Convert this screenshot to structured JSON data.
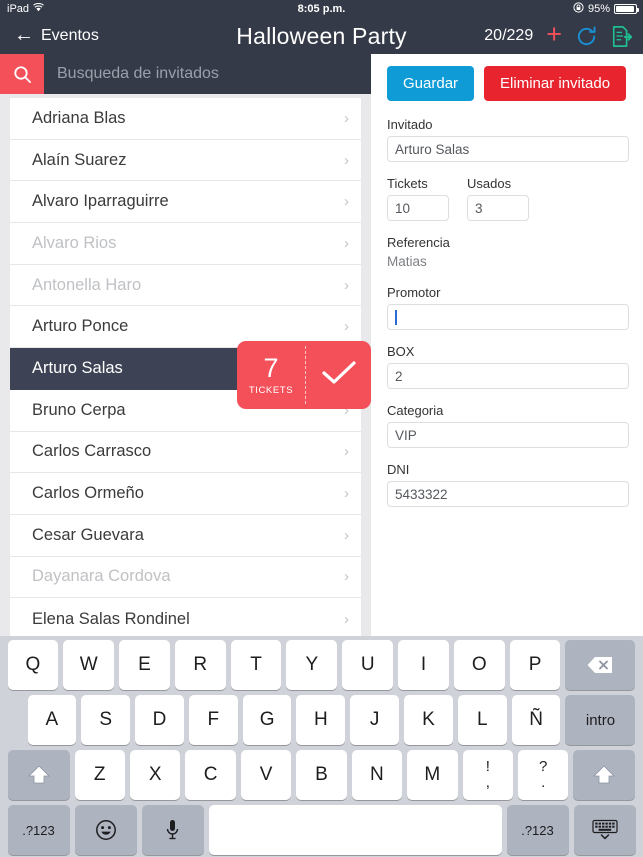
{
  "status_bar": {
    "device": "iPad",
    "wifi_icon": "wifi-icon",
    "time": "8:05 p.m.",
    "rotation_lock_icon": "rotation-lock-icon",
    "battery_percent": "95%"
  },
  "nav_bar": {
    "back_label": "Eventos",
    "back_icon": "back-arrow-icon",
    "title": "Halloween Party",
    "count": "20/229",
    "add_icon": "plus-icon",
    "refresh_icon": "refresh-icon",
    "export_icon": "export-document-icon",
    "accent_add": "#f4505a",
    "accent_refresh": "#1a8fd1",
    "accent_export": "#1fbf92"
  },
  "search": {
    "icon": "search-icon",
    "placeholder": "Busqueda de invitados",
    "value": ""
  },
  "guest_list": [
    {
      "name": "Adriana Blas",
      "dim": false,
      "selected": false
    },
    {
      "name": "Alaín Suarez",
      "dim": false,
      "selected": false
    },
    {
      "name": "Alvaro Iparraguirre",
      "dim": false,
      "selected": false
    },
    {
      "name": "Alvaro Rios",
      "dim": true,
      "selected": false
    },
    {
      "name": "Antonella Haro",
      "dim": true,
      "selected": false
    },
    {
      "name": "Arturo Ponce",
      "dim": false,
      "selected": false
    },
    {
      "name": "Arturo Salas",
      "dim": false,
      "selected": true
    },
    {
      "name": "Bruno Cerpa",
      "dim": false,
      "selected": false
    },
    {
      "name": "Carlos Carrasco",
      "dim": false,
      "selected": false
    },
    {
      "name": "Carlos Ormeño",
      "dim": false,
      "selected": false
    },
    {
      "name": "Cesar Guevara",
      "dim": false,
      "selected": false
    },
    {
      "name": "Dayanara Cordova",
      "dim": true,
      "selected": false
    },
    {
      "name": "Elena Salas Rondinel",
      "dim": false,
      "selected": false
    }
  ],
  "ticket_badge": {
    "count": "7",
    "label": "TICKETS",
    "check_icon": "checkmark-icon",
    "color": "#f4505a"
  },
  "detail": {
    "save_label": "Guardar",
    "delete_label": "Eliminar invitado",
    "save_color": "#0e9bd6",
    "delete_color": "#e8252f",
    "fields": {
      "invitado_label": "Invitado",
      "invitado_value": "Arturo Salas",
      "tickets_label": "Tickets",
      "tickets_value": "10",
      "usados_label": "Usados",
      "usados_value": "3",
      "referencia_label": "Referencia",
      "referencia_value": "Matias",
      "promotor_label": "Promotor",
      "promotor_value": "",
      "box_label": "BOX",
      "box_value": "2",
      "categoria_label": "Categoria",
      "categoria_value": "VIP",
      "dni_label": "DNI",
      "dni_value": "5433322"
    }
  },
  "keyboard": {
    "row1": [
      "Q",
      "W",
      "E",
      "R",
      "T",
      "Y",
      "U",
      "I",
      "O",
      "P"
    ],
    "row2": [
      "A",
      "S",
      "D",
      "F",
      "G",
      "H",
      "J",
      "K",
      "L",
      "Ñ"
    ],
    "row3": [
      "Z",
      "X",
      "C",
      "V",
      "B",
      "N",
      "M"
    ],
    "punct1_top": "!",
    "punct1_bot": ",",
    "punct2_top": "?",
    "punct2_bot": ".",
    "backspace_icon": "backspace-icon",
    "enter_label": "intro",
    "shift_icon": "shift-icon",
    "numbers_label": ".?123",
    "emoji_icon": "emoji-icon",
    "mic_icon": "microphone-icon",
    "space_label": "",
    "hide_keyboard_icon": "hide-keyboard-icon"
  }
}
